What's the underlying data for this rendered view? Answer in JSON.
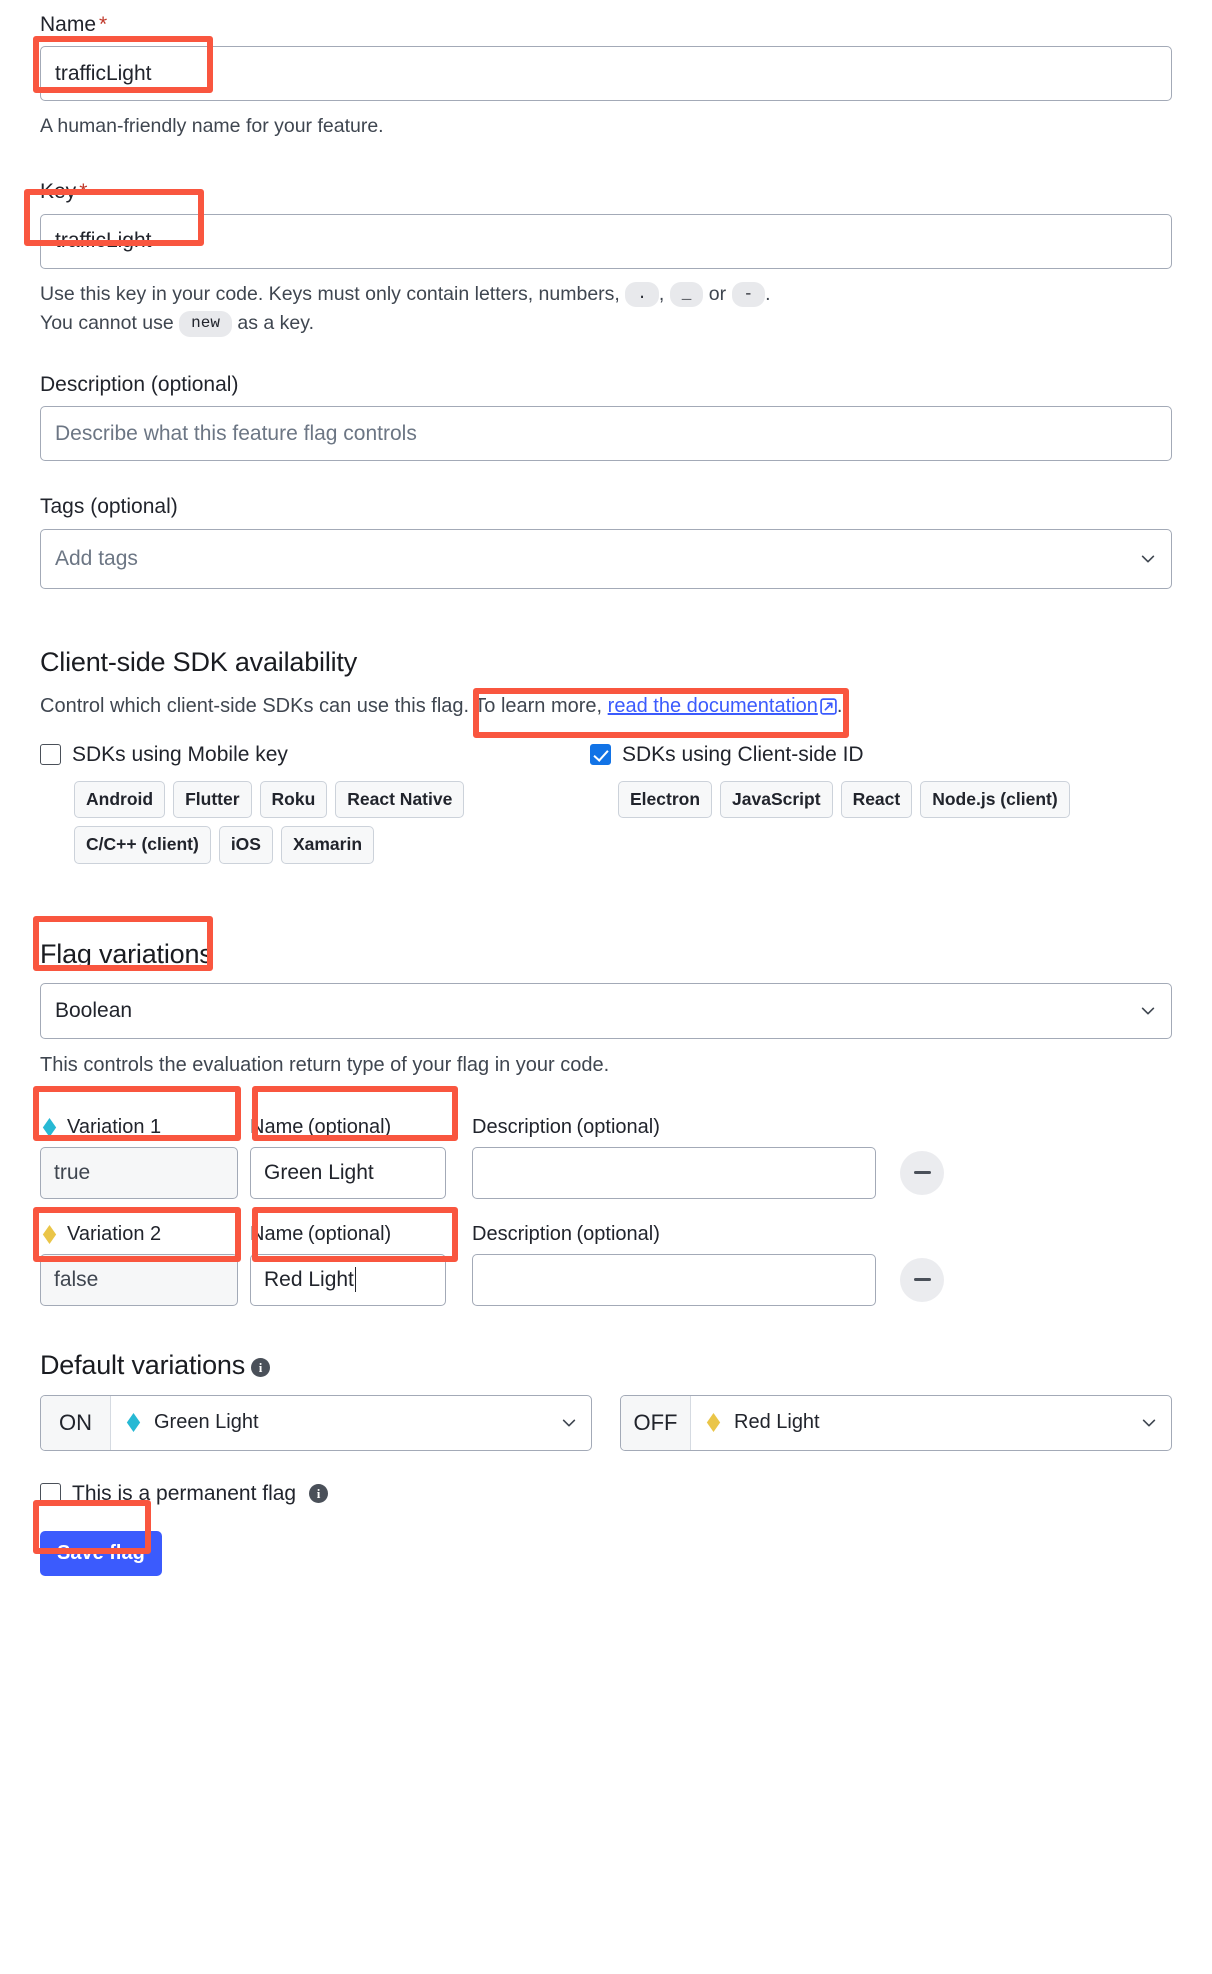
{
  "form": {
    "name": {
      "label": "Name",
      "required_mark": "*",
      "value": "trafficLight",
      "help": "A human-friendly name for your feature."
    },
    "key": {
      "label": "Key",
      "required_mark": "*",
      "value": "trafficLight",
      "help_part1": "Use this key in your code. Keys must only contain letters, numbers,",
      "help_chip_dot": ".",
      "help_comma": ",",
      "help_chip_underscore": "_",
      "help_or": "or",
      "help_chip_dash": "-",
      "help_period": ".",
      "help_part2": "You cannot use",
      "help_chip_new": "new",
      "help_part3": "as a key."
    },
    "description": {
      "label": "Description",
      "optional": "(optional)",
      "placeholder": "Describe what this feature flag controls",
      "value": ""
    },
    "tags": {
      "label": "Tags",
      "optional": "(optional)",
      "placeholder": "Add tags",
      "value": ""
    }
  },
  "sdk_section": {
    "title": "Client-side SDK availability",
    "description_before_link": "Control which client-side SDKs can use this flag. To learn more,",
    "link_text": "read the documentation",
    "description_after_link": ".",
    "mobile": {
      "checkbox_label": "SDKs using Mobile key",
      "checked": false,
      "chips": [
        "Android",
        "Flutter",
        "Roku",
        "React Native",
        "C/C++ (client)",
        "iOS",
        "Xamarin"
      ]
    },
    "client_side_id": {
      "checkbox_label": "SDKs using Client-side ID",
      "checked": true,
      "chips": [
        "Electron",
        "JavaScript",
        "React",
        "Node.js (client)"
      ]
    }
  },
  "variations_section": {
    "title": "Flag variations",
    "type_select_value": "Boolean",
    "type_help": "This controls the evaluation return type of your flag in your code.",
    "column_headers": {
      "name": "Name",
      "name_optional": "(optional)",
      "description": "Description",
      "description_optional": "(optional)"
    },
    "rows": [
      {
        "title": "Variation 1",
        "color": "#27b9d4",
        "value": "true",
        "name": "Green Light",
        "description": "",
        "remove_label": "remove variation"
      },
      {
        "title": "Variation 2",
        "color": "#eac548",
        "value": "false",
        "name": "Red Light",
        "description": "",
        "remove_label": "remove variation"
      }
    ]
  },
  "defaults_section": {
    "title": "Default variations",
    "on": {
      "tag": "ON",
      "value": "Green Light",
      "color": "#27b9d4"
    },
    "off": {
      "tag": "OFF",
      "value": "Red Light",
      "color": "#eac548"
    }
  },
  "permanent": {
    "label": "This is a permanent flag",
    "checked": false
  },
  "save": {
    "label": "Save flag"
  },
  "colors": {
    "highlight": "#f9563f",
    "primary": "#3b5bfd",
    "checkbox_blue": "#1273e6",
    "variation_1": "#27b9d4",
    "variation_2": "#eac548"
  }
}
